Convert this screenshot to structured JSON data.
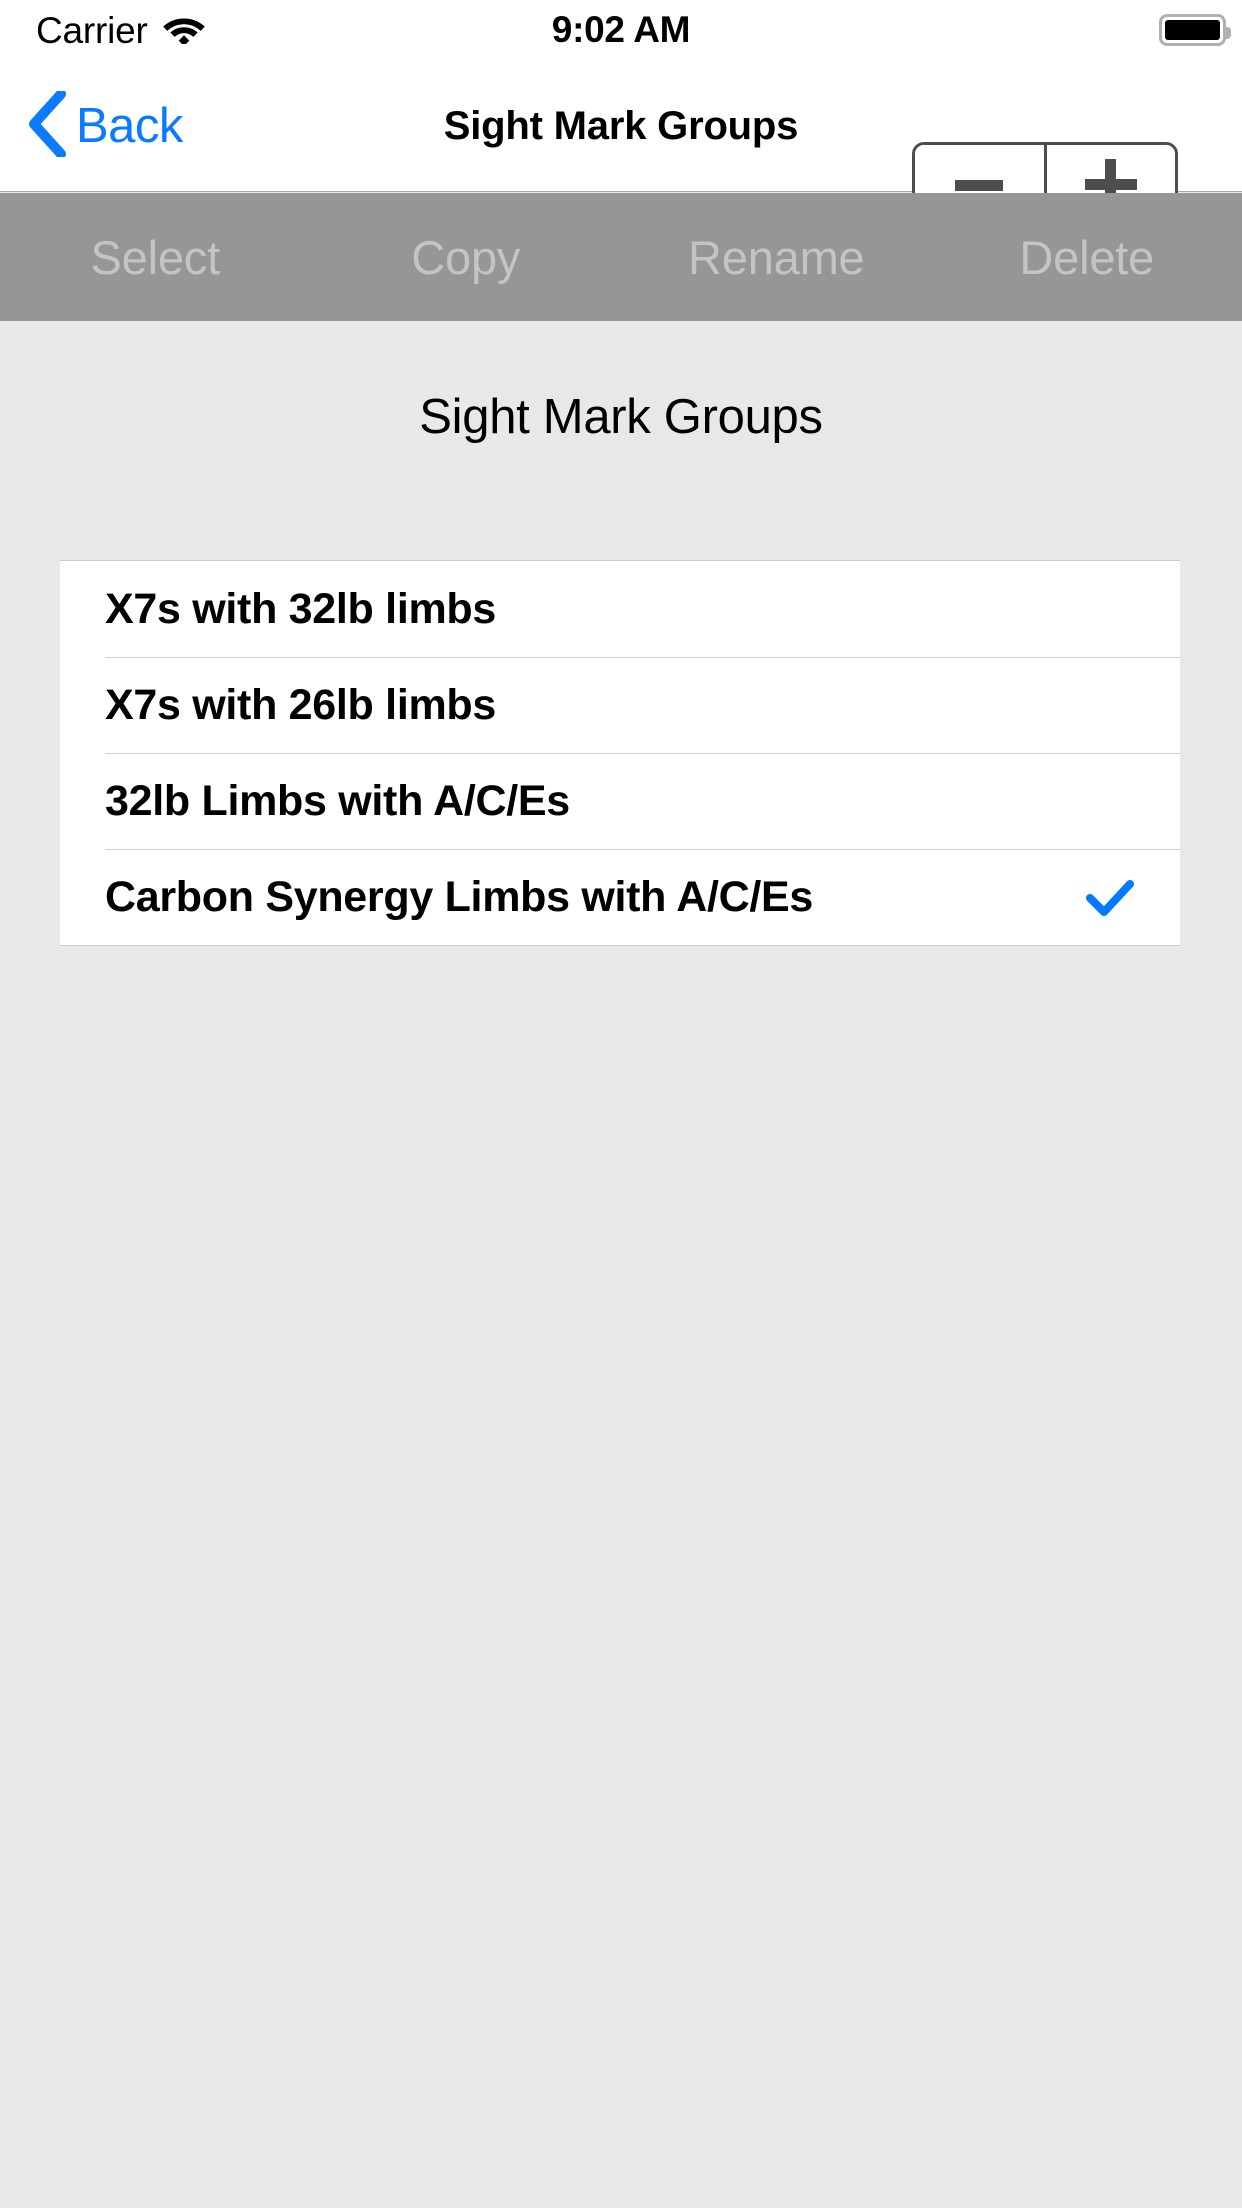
{
  "status_bar": {
    "carrier": "Carrier",
    "wifi_icon": "wifi-icon",
    "time": "9:02 AM",
    "battery_icon": "battery-full-icon"
  },
  "nav_bar": {
    "back_label": "Back",
    "back_icon": "chevron-left-icon",
    "title": "Sight Mark Groups",
    "stepper": {
      "decrement_icon": "minus-icon",
      "increment_icon": "plus-icon"
    }
  },
  "action_toolbar": {
    "enabled": false,
    "disabled_color": "#c4c4c4",
    "background_color": "#969696",
    "items": [
      {
        "label": "Select"
      },
      {
        "label": "Copy"
      },
      {
        "label": "Rename"
      },
      {
        "label": "Delete"
      }
    ]
  },
  "content": {
    "heading": "Sight Mark Groups",
    "accent_color": "#007aff",
    "groups": [
      {
        "label": "X7s with 32lb limbs",
        "selected": false
      },
      {
        "label": "X7s with 26lb limbs",
        "selected": false
      },
      {
        "label": "32lb Limbs with A/C/Es",
        "selected": false
      },
      {
        "label": "Carbon Synergy Limbs with A/C/Es",
        "selected": true,
        "check_icon": "checkmark-icon"
      }
    ]
  }
}
